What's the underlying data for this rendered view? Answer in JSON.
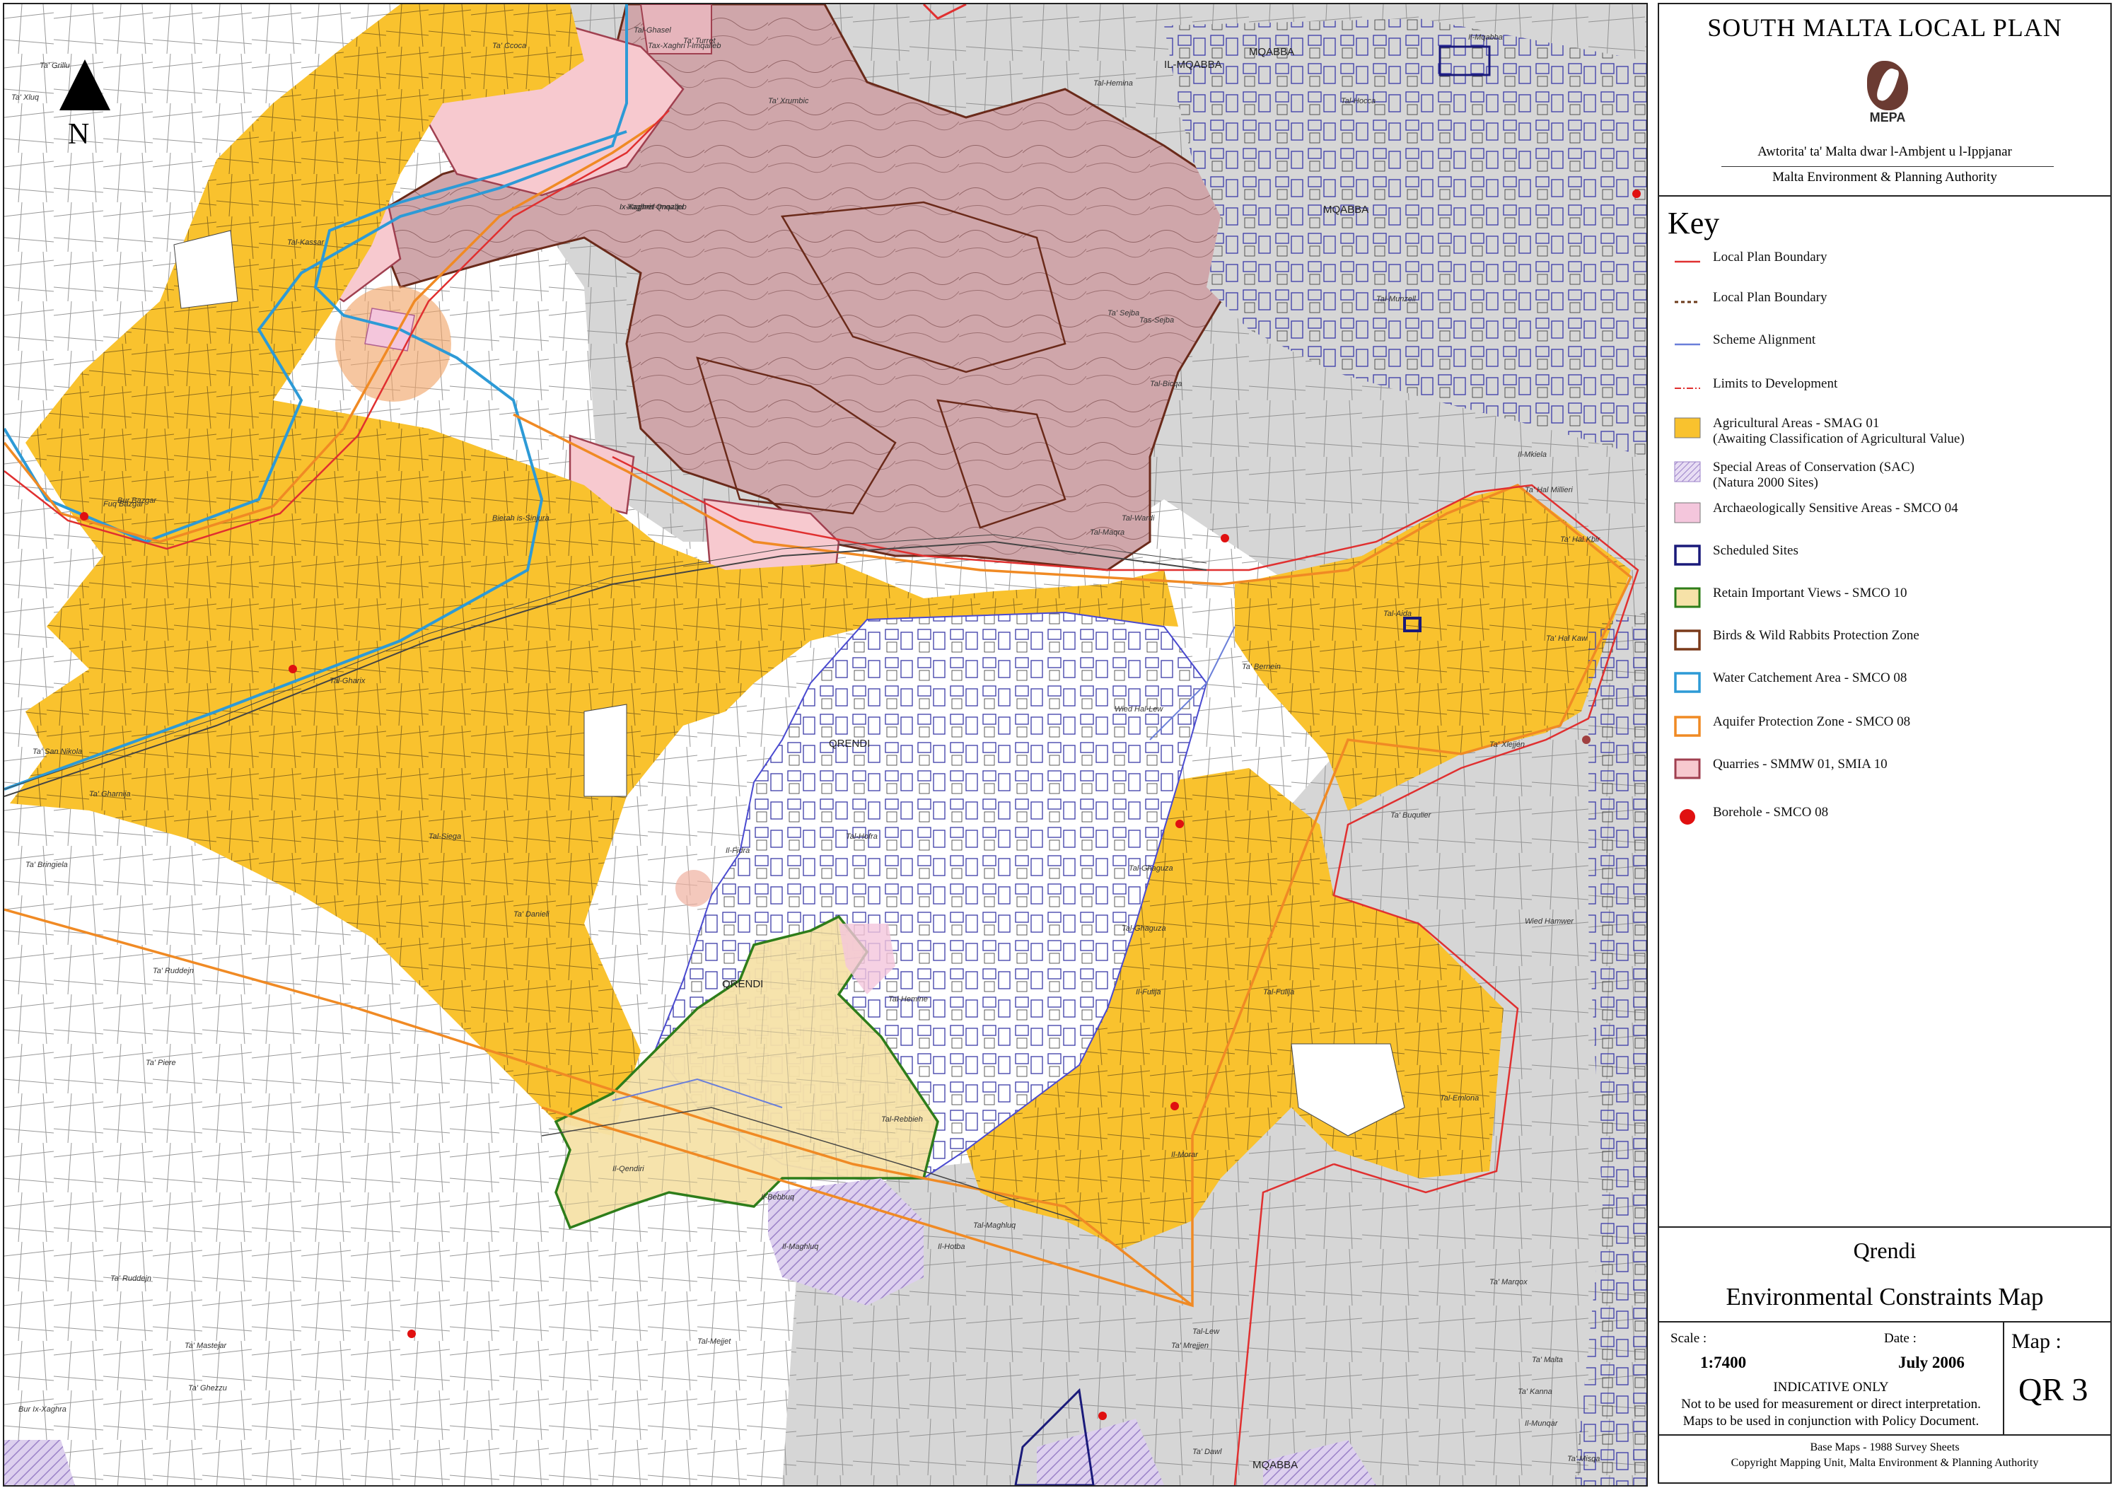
{
  "map": {
    "north_label": "N",
    "place_labels": [
      "Ta' Xluq",
      "Ta' Grillu",
      "Ta' Ccoca",
      "Tal-Ghasel",
      "Ta' Xrumbic",
      "Ta' Turret",
      "Tal-Kassar",
      "Fuq Bazgar",
      "Bur Bazgar",
      "Xaghret Qnazqu",
      "Bierah is-Sinjura",
      "Tal-Gharix",
      "Ta' San Nikola",
      "Ta' Gharnija",
      "Ta' Bringiela",
      "Tal-Siega",
      "Il-Fidra",
      "Ta' Danieli",
      "Ta' Ruddejn",
      "Ta' Piere",
      "Ta' Ruddejn",
      "Ta' Mastejar",
      "Ta' Ghezzu",
      "Il-Qendiri",
      "Il-Bebbuq",
      "Bur Ix-Xaghra",
      "Tal-Mejjet",
      "Il-Maghluq",
      "Tal-Rebbieh",
      "Il-Hotba",
      "Tal-Hemine",
      "Tal-Maghluq",
      "Il-Morar",
      "Wied Hal-Lew",
      "Tal-Ghaguza",
      "Tal-Ghaguza",
      "Il-Fulija",
      "Tal-Fulija",
      "Tal-Emlona",
      "Ta' Bernein",
      "Tal-Aida",
      "Ta' Buqulier",
      "Ta' Hal Millieri",
      "Tal-Bicqa",
      "Ix-Xaghra",
      "Tax-Xaghri l-Imqalleb",
      "Tal-Hemina",
      "Ix-Xaghri l-Imqalleb",
      "Tal-Maqra",
      "Ta' Sejba",
      "Tal-Wardi",
      "Tal-Hofra",
      "Il-Mkiela",
      "Tas-Sejba",
      "Tal-Munzell",
      "Ta' Hal Kbir",
      "Ta' Marqox",
      "Ta' Malta",
      "Il-Munqar",
      "Ta' Mrejjen",
      "Ta' Kanna",
      "Tal-Lew",
      "Ta' Hal Kaw",
      "Ta' Xlejjen",
      "Tal-Hocca",
      "Il-Mqabba",
      "Ta' Dawl",
      "Wied Hamwer",
      "Ta' Misqa"
    ],
    "town_labels": [
      "QRENDI",
      "QRENDI",
      "MQABBA",
      "MQABBA",
      "MQABBA",
      "IL-MQABBA"
    ]
  },
  "sidebar": {
    "plan_title": "SOUTH MALTA LOCAL PLAN",
    "logo_text": "MEPA",
    "authority_mt": "Awtorita' ta' Malta dwar l-Ambjent u l-Ippjanar",
    "authority_en": "Malta Environment & Planning Authority",
    "key_title": "Key",
    "legend": [
      {
        "id": "lp-boundary",
        "label": "Local Plan Boundary",
        "color": "#e03030",
        "symbol": "line"
      },
      {
        "id": "lp-boundary-dashed",
        "label": "Local Plan Boundary",
        "color": "#6b3a1a",
        "symbol": "dashed"
      },
      {
        "id": "scheme",
        "label": "Scheme Alignment",
        "color": "#6a7fd9",
        "symbol": "line"
      },
      {
        "id": "limits",
        "label": "Limits to Development",
        "color": "#e03030",
        "symbol": "dashdot"
      },
      {
        "id": "agri",
        "label": "Agricultural Areas - SMAG 01",
        "label2": "(Awaiting Classification of Agricultural Value)",
        "color": "#f9c22e",
        "symbol": "fill"
      },
      {
        "id": "sac",
        "label": "Special Areas of Conservation (SAC)",
        "label2": "(Natura 2000 Sites)",
        "color": "#c9b6e6",
        "symbol": "hatch"
      },
      {
        "id": "archaeo",
        "label": "Archaeologically Sensitive Areas - SMCO 04",
        "color": "#f4c6dc",
        "symbol": "fill"
      },
      {
        "id": "scheduled",
        "label": "Scheduled Sites",
        "color": "#1a1a7a",
        "symbol": "box"
      },
      {
        "id": "views",
        "label": "Retain Important Views - SMCO 10",
        "color": "#2e7d1a",
        "symbol": "boxfill",
        "fill": "#f6e2a8"
      },
      {
        "id": "birds",
        "label": "Birds & Wild Rabbits Protection Zone",
        "color": "#7a3a1a",
        "symbol": "box"
      },
      {
        "id": "water",
        "label": "Water Catchement Area - SMCO 08",
        "color": "#2d9ad6",
        "symbol": "box"
      },
      {
        "id": "aquifer",
        "label": "Aquifer Protection Zone - SMCO 08",
        "color": "#f08a24",
        "symbol": "box"
      },
      {
        "id": "quarries",
        "label": "Quarries - SMMW 01, SMIA 10",
        "color": "#a04050",
        "symbol": "boxfill",
        "fill": "#f7c9cf"
      },
      {
        "id": "borehole",
        "label": "Borehole - SMCO 08",
        "color": "#e01010",
        "symbol": "dot"
      }
    ],
    "map_place": "Qrendi",
    "map_name": "Environmental Constraints Map",
    "scale_label": "Scale :",
    "scale_value": "1:7400",
    "date_label": "Date :",
    "date_value": "July 2006",
    "indicative_1": "INDICATIVE ONLY",
    "indicative_2": "Not to be used for measurement or direct interpretation.",
    "indicative_3": "Maps to be used in conjunction with Policy Document.",
    "mapno_label": "Map :",
    "mapno_value": "QR 3",
    "basemap_1": "Base Maps - 1988 Survey Sheets",
    "basemap_2": "Copyright Mapping Unit, Malta Environment & Planning Authority"
  }
}
